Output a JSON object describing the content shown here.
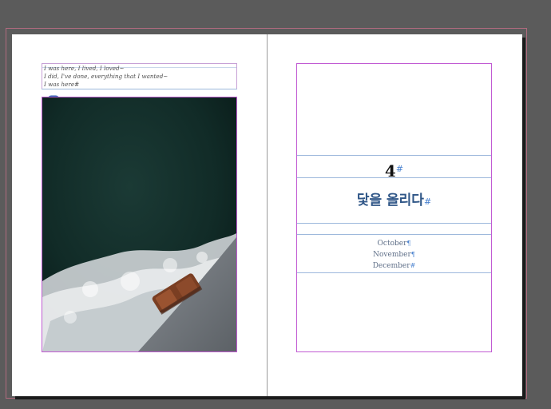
{
  "left_page": {
    "poem_lines": [
      "I was here, I lived, I loved~",
      "I did, I've done, everything that I wanted~",
      "I was here#"
    ],
    "link_icon": "chain-link-icon",
    "image": "ocean-wake-with-life-raft-photo"
  },
  "right_page": {
    "chapter_number": "4",
    "chapter_number_mark": "#",
    "chapter_title": "닻을 올리다",
    "chapter_title_mark": "#",
    "months": [
      {
        "label": "October",
        "mark": "¶"
      },
      {
        "label": "November",
        "mark": "¶"
      },
      {
        "label": "December",
        "mark": "#"
      }
    ]
  },
  "colors": {
    "pasteboard": "#5b5b5b",
    "frame_edge": "#c15bd3",
    "guide": "#9db8dc",
    "title_blue": "#2f5687",
    "hidden_char": "#4f86d1"
  }
}
